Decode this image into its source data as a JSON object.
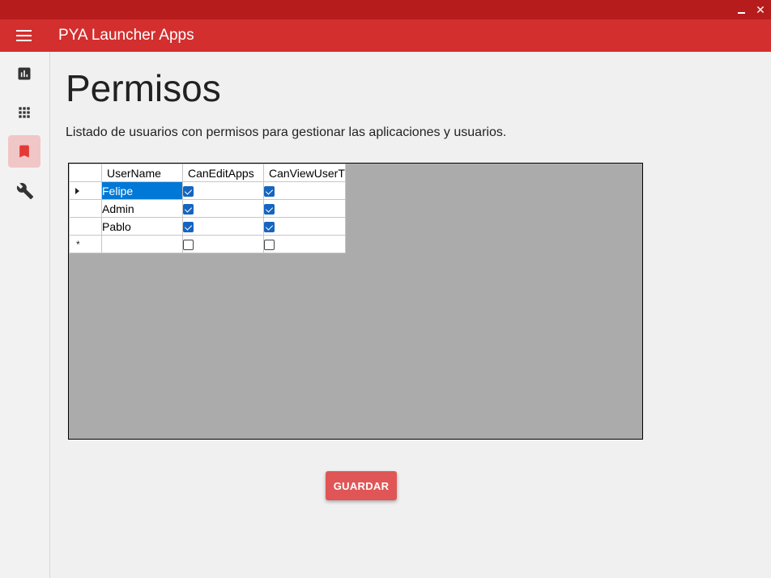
{
  "window": {
    "minimize_icon": "minimize-icon",
    "close_icon": "close-icon",
    "close_glyph": "✕"
  },
  "appbar": {
    "title": "PYA Launcher Apps",
    "menu_icon": "hamburger-menu-icon"
  },
  "sidebar": {
    "items": [
      {
        "icon": "bar-chart-icon",
        "active": false
      },
      {
        "icon": "apps-grid-icon",
        "active": false
      },
      {
        "icon": "bookmark-icon",
        "active": true
      },
      {
        "icon": "wrench-icon",
        "active": false
      }
    ]
  },
  "page": {
    "title": "Permisos",
    "description": "Listado de usuarios con permisos para gestionar las aplicaciones y usuarios."
  },
  "grid": {
    "columns": [
      "UserName",
      "CanEditApps",
      "CanViewUserT"
    ],
    "rows": [
      {
        "username": "Felipe",
        "can_edit_apps": true,
        "can_view_users": true,
        "selected": true
      },
      {
        "username": "Admin",
        "can_edit_apps": true,
        "can_view_users": true,
        "selected": false
      },
      {
        "username": "Pablo",
        "can_edit_apps": true,
        "can_view_users": true,
        "selected": false
      },
      {
        "username": "",
        "can_edit_apps": false,
        "can_view_users": false,
        "selected": false
      }
    ],
    "current_row_marker": "▶",
    "new_row_marker": "*"
  },
  "actions": {
    "save_label": "GUARDAR"
  },
  "colors": {
    "titlebar": "#b71c1c",
    "appbar": "#d32f2f",
    "accent_button": "#e05656",
    "selection": "#0078d7",
    "checkbox": "#1565c0"
  }
}
